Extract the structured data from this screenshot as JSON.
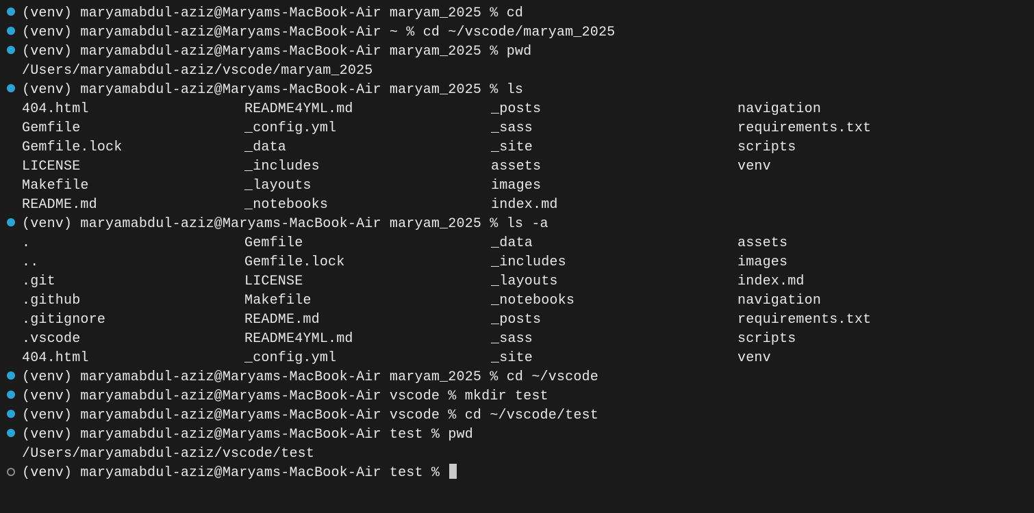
{
  "colors": {
    "bullet_active": "#29a4d4",
    "bullet_idle_border": "#8a8a8a",
    "bg": "#1a1a1a",
    "fg": "#e8e8e8"
  },
  "prompt": {
    "venv": "(venv)",
    "user": "maryamabdul-aziz",
    "host": "Maryams-MacBook-Air",
    "symbol": "%"
  },
  "lines": [
    {
      "type": "cmd",
      "bullet": "blue",
      "dir": "maryam_2025",
      "command": "cd"
    },
    {
      "type": "cmd",
      "bullet": "blue",
      "dir": "~",
      "command": "cd ~/vscode/maryam_2025"
    },
    {
      "type": "cmd",
      "bullet": "blue",
      "dir": "maryam_2025",
      "command": "pwd"
    },
    {
      "type": "out",
      "text": "/Users/maryamabdul-aziz/vscode/maryam_2025"
    },
    {
      "type": "cmd",
      "bullet": "blue",
      "dir": "maryam_2025",
      "command": "ls"
    },
    {
      "type": "ls",
      "rows": [
        [
          "404.html",
          "README4YML.md",
          "_posts",
          "navigation"
        ],
        [
          "Gemfile",
          "_config.yml",
          "_sass",
          "requirements.txt"
        ],
        [
          "Gemfile.lock",
          "_data",
          "_site",
          "scripts"
        ],
        [
          "LICENSE",
          "_includes",
          "assets",
          "venv"
        ],
        [
          "Makefile",
          "_layouts",
          "images",
          ""
        ],
        [
          "README.md",
          "_notebooks",
          "index.md",
          ""
        ]
      ]
    },
    {
      "type": "cmd",
      "bullet": "blue",
      "dir": "maryam_2025",
      "command": "ls -a"
    },
    {
      "type": "ls",
      "rows": [
        [
          ".",
          "Gemfile",
          "_data",
          "assets"
        ],
        [
          "..",
          "Gemfile.lock",
          "_includes",
          "images"
        ],
        [
          ".git",
          "LICENSE",
          "_layouts",
          "index.md"
        ],
        [
          ".github",
          "Makefile",
          "_notebooks",
          "navigation"
        ],
        [
          ".gitignore",
          "README.md",
          "_posts",
          "requirements.txt"
        ],
        [
          ".vscode",
          "README4YML.md",
          "_sass",
          "scripts"
        ],
        [
          "404.html",
          "_config.yml",
          "_site",
          "venv"
        ]
      ]
    },
    {
      "type": "cmd",
      "bullet": "blue",
      "dir": "maryam_2025",
      "command": "cd ~/vscode"
    },
    {
      "type": "cmd",
      "bullet": "blue",
      "dir": "vscode",
      "command": "mkdir test"
    },
    {
      "type": "cmd",
      "bullet": "blue",
      "dir": "vscode",
      "command": "cd ~/vscode/test"
    },
    {
      "type": "cmd",
      "bullet": "blue",
      "dir": "test",
      "command": "pwd"
    },
    {
      "type": "out",
      "text": "/Users/maryamabdul-aziz/vscode/test"
    },
    {
      "type": "cmd",
      "bullet": "hollow",
      "dir": "test",
      "command": "",
      "cursor": true
    }
  ]
}
